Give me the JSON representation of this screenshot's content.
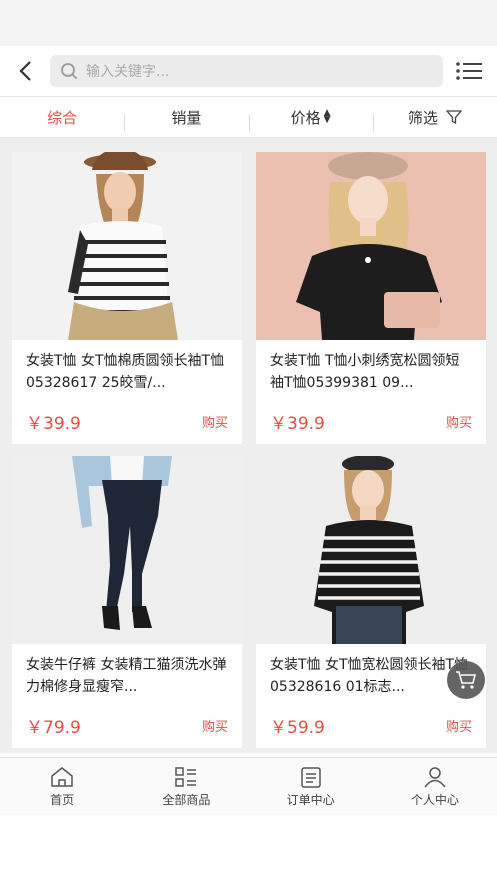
{
  "search": {
    "placeholder": "输入关键字..."
  },
  "sort_tabs": [
    {
      "label": "综合",
      "active": true
    },
    {
      "label": "销量"
    },
    {
      "label": "价格"
    },
    {
      "label": "筛选"
    }
  ],
  "products": [
    {
      "title": "女装T恤 女T恤棉质圆领长袖T恤05328617 25皎雪/...",
      "price": "￥39.9",
      "buy": "购买"
    },
    {
      "title": "女装T恤 T恤小刺绣宽松圆领短袖T恤05399381 09...",
      "price": "￥39.9",
      "buy": "购买"
    },
    {
      "title": "女装牛仔裤 女装精工猫须洗水弹力棉修身显瘦窄...",
      "price": "￥79.9",
      "buy": "购买"
    },
    {
      "title": "女装T恤 女T恤宽松圆领长袖T恤05328616 01标志...",
      "price": "￥59.9",
      "buy": "购买"
    }
  ],
  "tabbar": [
    {
      "label": "首页"
    },
    {
      "label": "全部商品"
    },
    {
      "label": "订单中心"
    },
    {
      "label": "个人中心"
    }
  ],
  "colors": {
    "accent": "#e84d42"
  }
}
